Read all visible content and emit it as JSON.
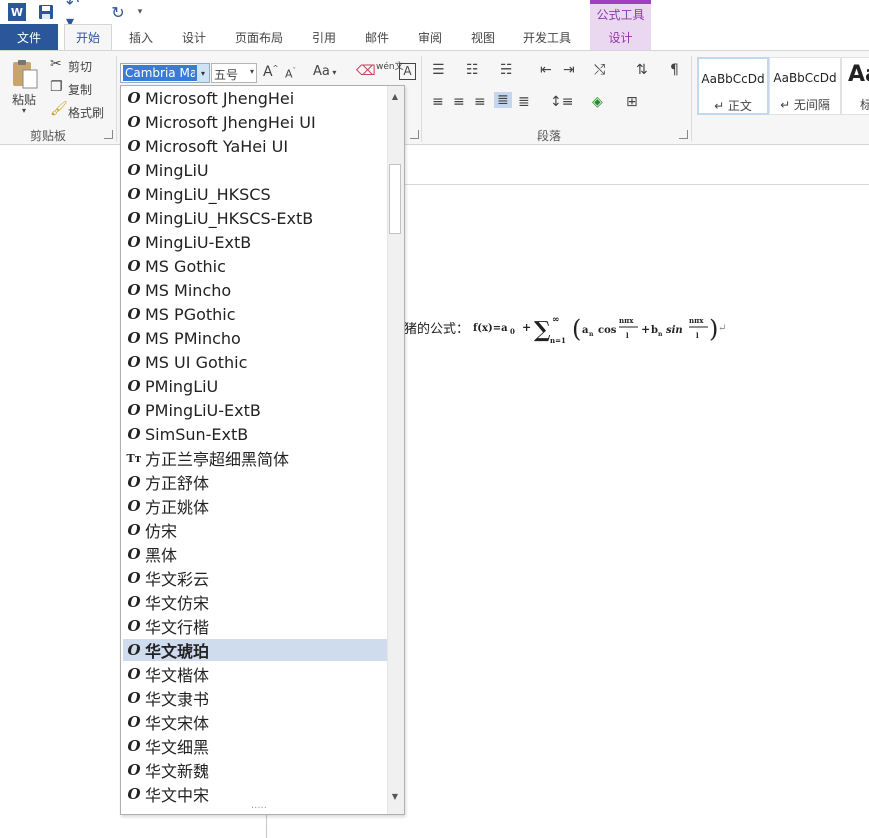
{
  "quick_access": {
    "app_letter": "W",
    "undo_glyph": "↶ ▾",
    "redo_glyph": "↻",
    "customize_glyph": "▾"
  },
  "context_tab_header": "公式工具",
  "tabs": [
    "文件",
    "开始",
    "插入",
    "设计",
    "页面布局",
    "引用",
    "邮件",
    "审阅",
    "视图",
    "开发工具",
    "设计"
  ],
  "clipboard": {
    "paste": "粘贴",
    "cut": "剪切",
    "copy": "复制",
    "format_painter": "格式刷",
    "group_label": "剪贴板"
  },
  "font": {
    "current": "Cambria Math",
    "size": "五号",
    "grow": "A",
    "shrink": "A",
    "case": "Aa",
    "phonetic": "wén文",
    "border_char": "A"
  },
  "paragraph_group_label": "段落",
  "styles": [
    {
      "preview": "AaBbCcDd",
      "name": "↵ 正文"
    },
    {
      "preview": "AaBbCcDd",
      "name": "↵ 无间隔"
    },
    {
      "preview": "Aa",
      "name": "标"
    }
  ],
  "document": {
    "text": "猪的公式：",
    "formula_glyphs": {
      "lhs": "f(x)=a",
      "sub0": "0",
      "plus": "+",
      "sum": "∑",
      "sup_inf": "∞",
      "sub_n1": "n=1",
      "lparen": "(",
      "a": "a",
      "cos": "cos",
      "frac_num": "nπx",
      "frac_den": "l",
      "b": "b",
      "sin": "sin",
      "sub_n": "n",
      "rparen": ")",
      "para_mark": "↵"
    }
  },
  "dropdown": {
    "fonts": [
      {
        "name": "Microsoft JhengHei",
        "type": "otf"
      },
      {
        "name": "Microsoft JhengHei UI",
        "type": "otf"
      },
      {
        "name": "Microsoft YaHei UI",
        "type": "otf"
      },
      {
        "name": "MingLiU",
        "type": "otf"
      },
      {
        "name": "MingLiU_HKSCS",
        "type": "otf"
      },
      {
        "name": "MingLiU_HKSCS-ExtB",
        "type": "otf"
      },
      {
        "name": "MingLiU-ExtB",
        "type": "otf"
      },
      {
        "name": "MS Gothic",
        "type": "otf"
      },
      {
        "name": "MS Mincho",
        "type": "otf"
      },
      {
        "name": "MS PGothic",
        "type": "otf"
      },
      {
        "name": "MS PMincho",
        "type": "otf"
      },
      {
        "name": "MS UI Gothic",
        "type": "otf"
      },
      {
        "name": "PMingLiU",
        "type": "otf"
      },
      {
        "name": "PMingLiU-ExtB",
        "type": "otf"
      },
      {
        "name": "SimSun-ExtB",
        "type": "otf"
      },
      {
        "name": "方正兰亭超细黑简体",
        "type": "ttf"
      },
      {
        "name": "方正舒体",
        "type": "otf"
      },
      {
        "name": "方正姚体",
        "type": "otf"
      },
      {
        "name": "仿宋",
        "type": "otf"
      },
      {
        "name": "黑体",
        "type": "otf"
      },
      {
        "name": "华文彩云",
        "type": "otf"
      },
      {
        "name": "华文仿宋",
        "type": "otf"
      },
      {
        "name": "华文行楷",
        "type": "otf"
      },
      {
        "name": "华文琥珀",
        "type": "otf",
        "selected": true
      },
      {
        "name": "华文楷体",
        "type": "otf"
      },
      {
        "name": "华文隶书",
        "type": "otf"
      },
      {
        "name": "华文宋体",
        "type": "otf"
      },
      {
        "name": "华文细黑",
        "type": "otf"
      },
      {
        "name": "华文新魏",
        "type": "otf"
      },
      {
        "name": "华文中宋",
        "type": "otf"
      }
    ],
    "otf_glyph": "O",
    "ttf_glyph": "Tт",
    "scroll_up": "▲",
    "scroll_down": "▼",
    "grip": "....."
  },
  "colors": {
    "word_blue": "#2b579a",
    "context_purple": "#a040c0",
    "selection": "#cfdcee"
  }
}
